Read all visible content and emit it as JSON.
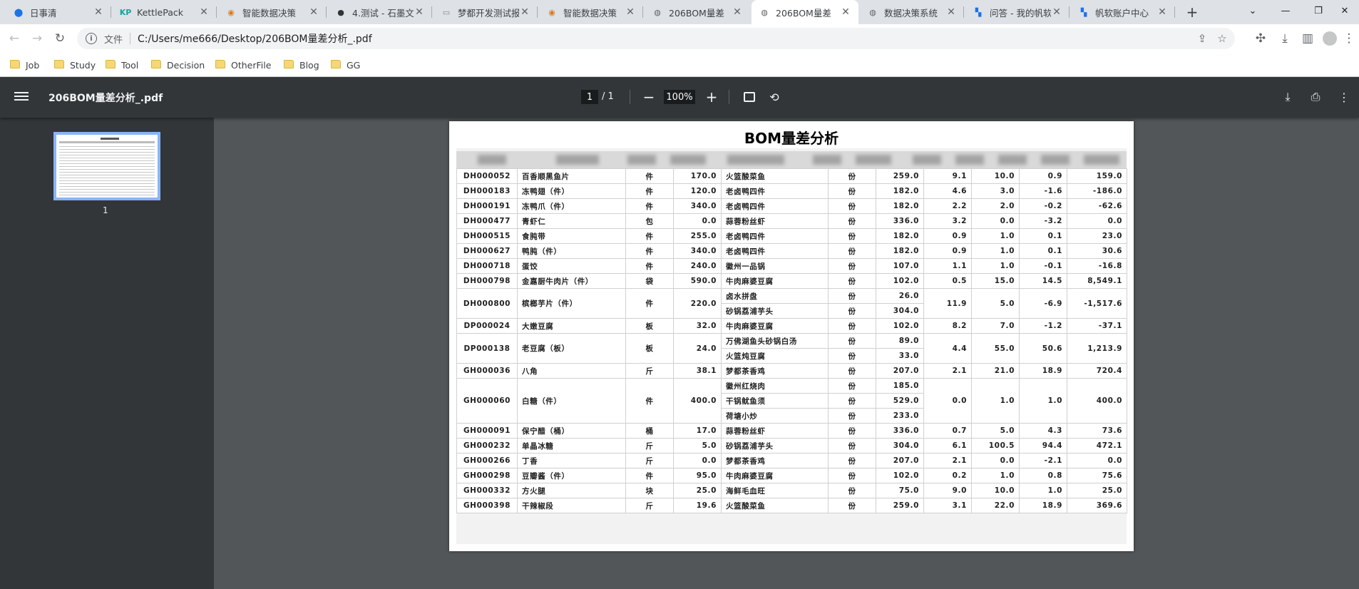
{
  "tabs": [
    {
      "title": "日事清",
      "icon": "location-pin-icon"
    },
    {
      "title": "KettlePack",
      "icon": "kp-logo-icon"
    },
    {
      "title": "智能数据决策",
      "icon": "decision-logo-icon"
    },
    {
      "title": "4.测试 - 石墨文",
      "icon": "shimo-logo-icon"
    },
    {
      "title": "梦都开发测试报",
      "icon": "document-icon"
    },
    {
      "title": "智能数据决策",
      "icon": "decision-logo-icon"
    },
    {
      "title": "206BOM量差",
      "icon": "globe-icon"
    },
    {
      "title": "206BOM量差",
      "icon": "globe-icon",
      "active": true
    },
    {
      "title": "数据决策系统",
      "icon": "globe-icon"
    },
    {
      "title": "问答 - 我的帆软",
      "icon": "fanruan-logo-icon"
    },
    {
      "title": "帆软账户中心",
      "icon": "fanruan-logo-icon"
    }
  ],
  "address": {
    "scheme_label": "文件",
    "url": "C:/Users/me666/Desktop/206BOM量差分析_.pdf"
  },
  "bookmarks": [
    "Job",
    "Study",
    "Tool",
    "Decision",
    "OtherFile",
    "Blog",
    "GG"
  ],
  "pdf": {
    "filename": "206BOM量差分析_.pdf",
    "page_current": "1",
    "page_total": "/ 1",
    "zoom": "100%",
    "thumb_label": "1",
    "doc_title": "BOM量差分析"
  },
  "rows": [
    {
      "code": "DH000052",
      "name": "百香顺黑鱼片",
      "unit": "件",
      "qty": "170.0",
      "items": [
        {
          "dish": "火篮酸菜鱼",
          "u": "份",
          "n": "259.0"
        }
      ],
      "a": "9.1",
      "b": "10.0",
      "d": "0.9",
      "e": "159.0",
      "neg": false
    },
    {
      "code": "DH000183",
      "name": "冻鸭翅（件）",
      "unit": "件",
      "qty": "120.0",
      "items": [
        {
          "dish": "老卤鸭四件",
          "u": "份",
          "n": "182.0"
        }
      ],
      "a": "4.6",
      "b": "3.0",
      "d": "-1.6",
      "e": "-186.0",
      "neg": true
    },
    {
      "code": "DH000191",
      "name": "冻鸭爪（件）",
      "unit": "件",
      "qty": "340.0",
      "items": [
        {
          "dish": "老卤鸭四件",
          "u": "份",
          "n": "182.0"
        }
      ],
      "a": "2.2",
      "b": "2.0",
      "d": "-0.2",
      "e": "-62.6",
      "neg": true
    },
    {
      "code": "DH000477",
      "name": "青虾仁",
      "unit": "包",
      "qty": "0.0",
      "items": [
        {
          "dish": "蒜蓉粉丝虾",
          "u": "份",
          "n": "336.0"
        }
      ],
      "a": "3.2",
      "b": "0.0",
      "d": "-3.2",
      "e": "0.0",
      "neg": true,
      "e_plain": true
    },
    {
      "code": "DH000515",
      "name": "食肫带",
      "unit": "件",
      "qty": "255.0",
      "items": [
        {
          "dish": "老卤鸭四件",
          "u": "份",
          "n": "182.0"
        }
      ],
      "a": "0.9",
      "b": "1.0",
      "d": "0.1",
      "e": "23.0",
      "neg": false
    },
    {
      "code": "DH000627",
      "name": "鸭肫（件）",
      "unit": "件",
      "qty": "340.0",
      "items": [
        {
          "dish": "老卤鸭四件",
          "u": "份",
          "n": "182.0"
        }
      ],
      "a": "0.9",
      "b": "1.0",
      "d": "0.1",
      "e": "30.6",
      "neg": false
    },
    {
      "code": "DH000718",
      "name": "蛋饺",
      "unit": "件",
      "qty": "240.0",
      "items": [
        {
          "dish": "徽州一品锅",
          "u": "份",
          "n": "107.0"
        }
      ],
      "a": "1.1",
      "b": "1.0",
      "d": "-0.1",
      "e": "-16.8",
      "neg": true
    },
    {
      "code": "DH000798",
      "name": "金嘉厨牛肉片（件）",
      "unit": "袋",
      "qty": "590.0",
      "items": [
        {
          "dish": "牛肉麻婆豆腐",
          "u": "份",
          "n": "102.0"
        }
      ],
      "a": "0.5",
      "b": "15.0",
      "d": "14.5",
      "e": "8,549.1",
      "neg": false
    },
    {
      "code": "DH000800",
      "name": "槟榔芋片（件）",
      "unit": "件",
      "qty": "220.0",
      "items": [
        {
          "dish": "卤水拼盘",
          "u": "份",
          "n": "26.0"
        },
        {
          "dish": "砂锅荔浦芋头",
          "u": "份",
          "n": "304.0"
        }
      ],
      "a": "11.9",
      "b": "5.0",
      "d": "-6.9",
      "e": "-1,517.6",
      "neg": true
    },
    {
      "code": "DP000024",
      "name": "大嫩豆腐",
      "unit": "板",
      "qty": "32.0",
      "items": [
        {
          "dish": "牛肉麻婆豆腐",
          "u": "份",
          "n": "102.0"
        }
      ],
      "a": "8.2",
      "b": "7.0",
      "d": "-1.2",
      "e": "-37.1",
      "neg": true
    },
    {
      "code": "DP000138",
      "name": "老豆腐（板）",
      "unit": "板",
      "qty": "24.0",
      "items": [
        {
          "dish": "万佛湖鱼头砂锅白汤",
          "u": "份",
          "n": "89.0"
        },
        {
          "dish": "火篮炖豆腐",
          "u": "份",
          "n": "33.0"
        }
      ],
      "a": "4.4",
      "b": "55.0",
      "d": "50.6",
      "e": "1,213.9",
      "neg": false
    },
    {
      "code": "GH000036",
      "name": "八角",
      "unit": "斤",
      "qty": "38.1",
      "items": [
        {
          "dish": "梦都茶香鸡",
          "u": "份",
          "n": "207.0"
        }
      ],
      "a": "2.1",
      "b": "21.0",
      "d": "18.9",
      "e": "720.4",
      "neg": false
    },
    {
      "code": "GH000060",
      "name": "白糖（件）",
      "unit": "件",
      "qty": "400.0",
      "items": [
        {
          "dish": "徽州红烧肉",
          "u": "份",
          "n": "185.0"
        },
        {
          "dish": "干锅鱿鱼须",
          "u": "份",
          "n": "529.0"
        },
        {
          "dish": "荷塘小炒",
          "u": "份",
          "n": "233.0"
        }
      ],
      "a": "0.0",
      "b": "1.0",
      "d": "1.0",
      "e": "400.0",
      "neg": false
    },
    {
      "code": "GH000091",
      "name": "保宁醋（桶）",
      "unit": "桶",
      "qty": "17.0",
      "items": [
        {
          "dish": "蒜蓉粉丝虾",
          "u": "份",
          "n": "336.0"
        }
      ],
      "a": "0.7",
      "b": "5.0",
      "d": "4.3",
      "e": "73.6",
      "neg": false
    },
    {
      "code": "GH000232",
      "name": "单晶冰糖",
      "unit": "斤",
      "qty": "5.0",
      "items": [
        {
          "dish": "砂锅荔浦芋头",
          "u": "份",
          "n": "304.0"
        }
      ],
      "a": "6.1",
      "b": "100.5",
      "d": "94.4",
      "e": "472.1",
      "neg": false
    },
    {
      "code": "GH000266",
      "name": "丁香",
      "unit": "斤",
      "qty": "0.0",
      "items": [
        {
          "dish": "梦都茶香鸡",
          "u": "份",
          "n": "207.0"
        }
      ],
      "a": "2.1",
      "b": "0.0",
      "d": "-2.1",
      "e": "0.0",
      "neg": true,
      "e_plain": true
    },
    {
      "code": "GH000298",
      "name": "豆瓣酱（件）",
      "unit": "件",
      "qty": "95.0",
      "items": [
        {
          "dish": "牛肉麻婆豆腐",
          "u": "份",
          "n": "102.0"
        }
      ],
      "a": "0.2",
      "b": "1.0",
      "d": "0.8",
      "e": "75.6",
      "neg": false
    },
    {
      "code": "GH000332",
      "name": "方火腿",
      "unit": "块",
      "qty": "25.0",
      "items": [
        {
          "dish": "海鲜毛血旺",
          "u": "份",
          "n": "75.0"
        }
      ],
      "a": "9.0",
      "b": "10.0",
      "d": "1.0",
      "e": "25.0",
      "neg": false
    },
    {
      "code": "GH000398",
      "name": "干辣椒段",
      "unit": "斤",
      "qty": "19.6",
      "items": [
        {
          "dish": "火篮酸菜鱼",
          "u": "份",
          "n": "259.0"
        }
      ],
      "a": "3.1",
      "b": "22.0",
      "d": "18.9",
      "e": "369.6",
      "neg": false
    }
  ]
}
